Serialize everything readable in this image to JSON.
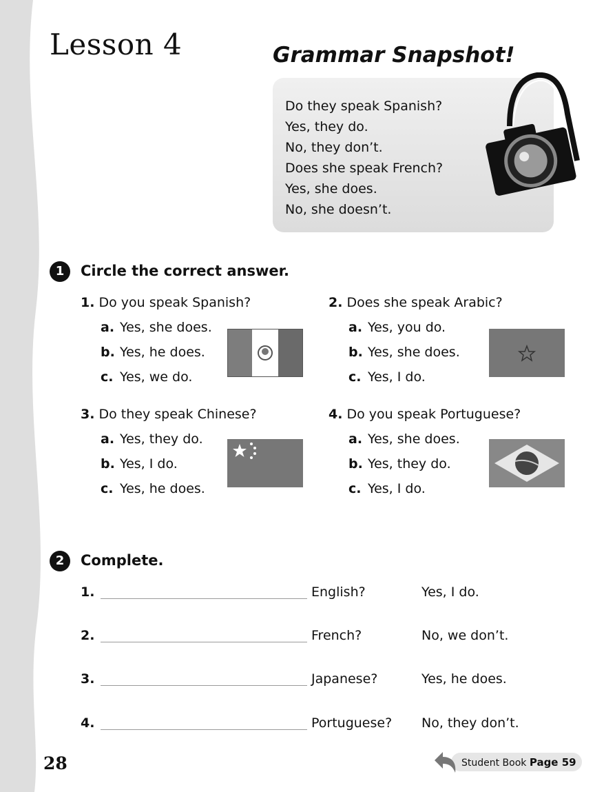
{
  "lesson_title": "Lesson 4",
  "grammar": {
    "title": "Grammar Snapshot!",
    "lines": [
      "Do they speak Spanish?",
      "Yes, they do.",
      "No, they don’t.",
      "Does she speak French?",
      "Yes, she does.",
      "No, she doesn’t."
    ]
  },
  "section1": {
    "num": "1",
    "title": "Circle the correct answer.",
    "questions": [
      {
        "num": "1.",
        "text": "Do you speak Spanish?",
        "options": [
          {
            "l": "a.",
            "t": "Yes, she does."
          },
          {
            "l": "b.",
            "t": "Yes, he does."
          },
          {
            "l": "c.",
            "t": "Yes, we do."
          }
        ]
      },
      {
        "num": "2.",
        "text": "Does she speak Arabic?",
        "options": [
          {
            "l": "a.",
            "t": "Yes, you do."
          },
          {
            "l": "b.",
            "t": "Yes, she does."
          },
          {
            "l": "c.",
            "t": "Yes, I do."
          }
        ]
      },
      {
        "num": "3.",
        "text": "Do they speak Chinese?",
        "options": [
          {
            "l": "a.",
            "t": "Yes, they do."
          },
          {
            "l": "b.",
            "t": "Yes, I do."
          },
          {
            "l": "c.",
            "t": "Yes, he does."
          }
        ]
      },
      {
        "num": "4.",
        "text": "Do you speak Portuguese?",
        "options": [
          {
            "l": "a.",
            "t": "Yes, she does."
          },
          {
            "l": "b.",
            "t": "Yes, they do."
          },
          {
            "l": "c.",
            "t": "Yes, I do."
          }
        ]
      }
    ]
  },
  "section2": {
    "num": "2",
    "title": "Complete.",
    "items": [
      {
        "num": "1.",
        "word": "English?",
        "answer": "Yes, I do."
      },
      {
        "num": "2.",
        "word": "French?",
        "answer": "No, we don’t."
      },
      {
        "num": "3.",
        "word": "Japanese?",
        "answer": "Yes, he does."
      },
      {
        "num": "4.",
        "word": "Portuguese?",
        "answer": "No, they don’t."
      }
    ]
  },
  "footer": {
    "page_number": "28",
    "student_book_label": "Student Book",
    "page_ref": "Page 59"
  }
}
